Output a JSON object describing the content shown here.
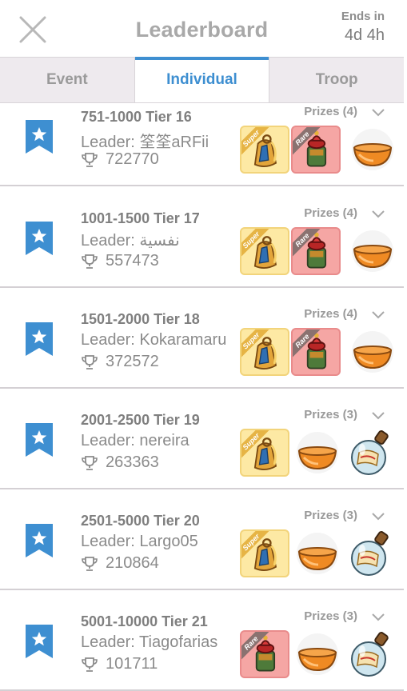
{
  "header": {
    "title": "Leaderboard",
    "ends_label": "Ends in",
    "ends_value": "4d 4h"
  },
  "tabs": [
    {
      "label": "Event",
      "active": false
    },
    {
      "label": "Individual",
      "active": true
    },
    {
      "label": "Troop",
      "active": false
    }
  ],
  "rows": [
    {
      "tier": "751-1000  Tier 16",
      "leader": "Leader: 筌筌aRFii",
      "score": "722770",
      "prizes_label": "Prizes (4)",
      "prizes": [
        {
          "kind": "super",
          "label": "Super",
          "icon": "horn-icon"
        },
        {
          "kind": "rare",
          "label": "Rare",
          "icon": "lantern-icon"
        },
        {
          "kind": "plain",
          "icon": "bowl-icon"
        }
      ]
    },
    {
      "tier": "1001-1500  Tier 17",
      "leader": "Leader: نفسية",
      "score": "557473",
      "prizes_label": "Prizes (4)",
      "prizes": [
        {
          "kind": "super",
          "label": "Super",
          "icon": "horn-icon"
        },
        {
          "kind": "rare",
          "label": "Rare",
          "icon": "lantern-icon"
        },
        {
          "kind": "plain",
          "icon": "bowl-icon"
        }
      ]
    },
    {
      "tier": "1501-2000  Tier 18",
      "leader": "Leader: Kokaramaru",
      "score": "372572",
      "prizes_label": "Prizes (4)",
      "prizes": [
        {
          "kind": "super",
          "label": "Super",
          "icon": "horn-icon"
        },
        {
          "kind": "rare",
          "label": "Rare",
          "icon": "lantern-icon"
        },
        {
          "kind": "plain",
          "icon": "bowl-icon"
        }
      ]
    },
    {
      "tier": "2001-2500  Tier 19",
      "leader": "Leader: nereira",
      "score": "263363",
      "prizes_label": "Prizes (3)",
      "prizes": [
        {
          "kind": "super",
          "label": "Super",
          "icon": "horn-icon"
        },
        {
          "kind": "plain",
          "icon": "bowl-icon"
        },
        {
          "kind": "plain",
          "icon": "scroll-bottle-icon"
        }
      ]
    },
    {
      "tier": "2501-5000  Tier 20",
      "leader": "Leader: Largo05",
      "score": "210864",
      "prizes_label": "Prizes (3)",
      "prizes": [
        {
          "kind": "super",
          "label": "Super",
          "icon": "horn-icon"
        },
        {
          "kind": "plain",
          "icon": "bowl-icon"
        },
        {
          "kind": "plain",
          "icon": "scroll-bottle-icon"
        }
      ]
    },
    {
      "tier": "5001-10000  Tier 21",
      "leader": "Leader: Tiagofarias",
      "score": "101711",
      "prizes_label": "Prizes (3)",
      "prizes": [
        {
          "kind": "rare",
          "label": "Rare",
          "icon": "lantern-icon"
        },
        {
          "kind": "plain",
          "icon": "bowl-icon"
        },
        {
          "kind": "plain",
          "icon": "scroll-bottle-icon"
        }
      ]
    }
  ],
  "colors": {
    "accent": "#3e8fd1",
    "bookmark": "#3e8fd1",
    "super_bg": "#fde9a4",
    "rare_bg": "#f5a6a4",
    "tab_bar_bg": "#eeeaee"
  }
}
